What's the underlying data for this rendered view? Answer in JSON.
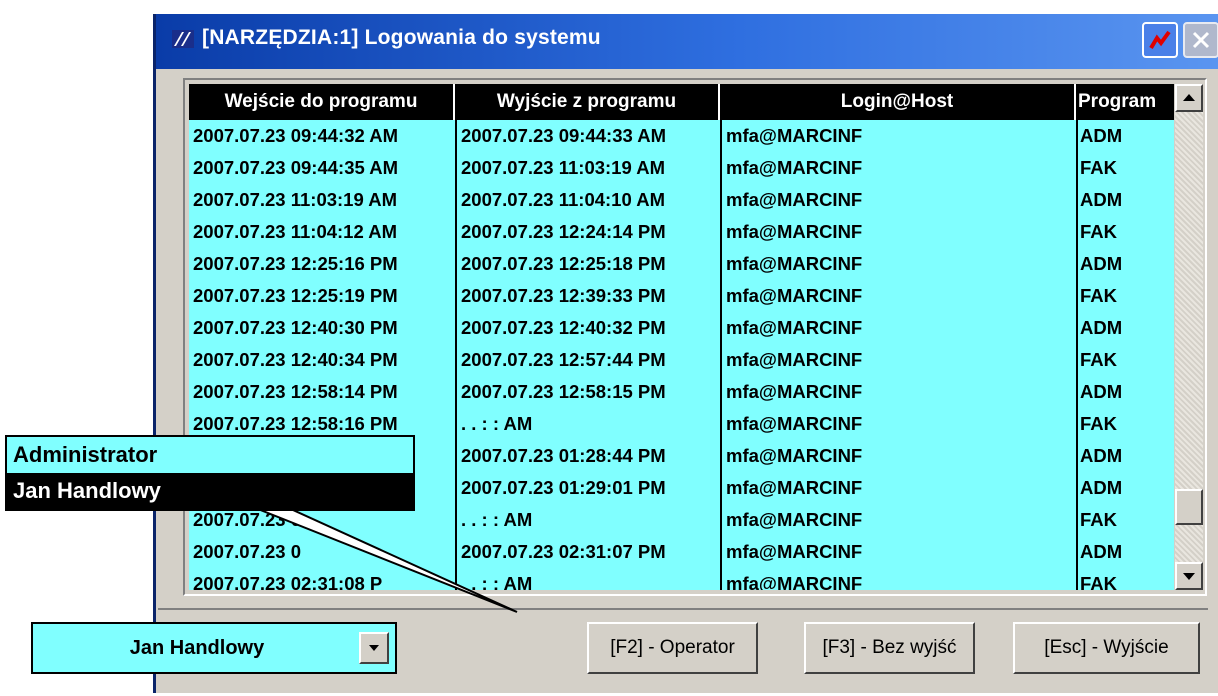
{
  "window": {
    "title": "[NARZĘDZIA:1]  Logowania do systemu"
  },
  "columns": [
    "Wejście do programu",
    "Wyjście z programu",
    "Login@Host",
    "Program"
  ],
  "rows": [
    [
      "2007.07.23 09:44:32 AM",
      "2007.07.23 09:44:33 AM",
      "mfa@MARCINF",
      "ADM"
    ],
    [
      "2007.07.23 09:44:35 AM",
      "2007.07.23 11:03:19 AM",
      "mfa@MARCINF",
      "FAK"
    ],
    [
      "2007.07.23 11:03:19 AM",
      "2007.07.23 11:04:10 AM",
      "mfa@MARCINF",
      "ADM"
    ],
    [
      "2007.07.23 11:04:12 AM",
      "2007.07.23 12:24:14 PM",
      "mfa@MARCINF",
      "FAK"
    ],
    [
      "2007.07.23 12:25:16 PM",
      "2007.07.23 12:25:18 PM",
      "mfa@MARCINF",
      "ADM"
    ],
    [
      "2007.07.23 12:25:19 PM",
      "2007.07.23 12:39:33 PM",
      "mfa@MARCINF",
      "FAK"
    ],
    [
      "2007.07.23 12:40:30 PM",
      "2007.07.23 12:40:32 PM",
      "mfa@MARCINF",
      "ADM"
    ],
    [
      "2007.07.23 12:40:34 PM",
      "2007.07.23 12:57:44 PM",
      "mfa@MARCINF",
      "FAK"
    ],
    [
      "2007.07.23 12:58:14 PM",
      "2007.07.23 12:58:15 PM",
      "mfa@MARCINF",
      "ADM"
    ],
    [
      "2007.07.23 12:58:16 PM",
      ". .   : :  AM",
      "mfa@MARCINF",
      "FAK"
    ],
    [
      "",
      "2007.07.23 01:28:44 PM",
      "mfa@MARCINF",
      "ADM"
    ],
    [
      "",
      "2007.07.23 01:29:01 PM",
      "mfa@MARCINF",
      "ADM"
    ],
    [
      "2007.07.23 0",
      ". .   : :  AM",
      "mfa@MARCINF",
      "FAK"
    ],
    [
      "2007.07.23 0",
      "2007.07.23 02:31:07 PM",
      "mfa@MARCINF",
      "ADM"
    ],
    [
      "2007.07.23 02:31:08 P",
      ". .   : :  AM",
      "mfa@MARCINF",
      "FAK"
    ]
  ],
  "operator_select": {
    "value": "Jan Handlowy",
    "options": [
      "Administrator",
      "Jan Handlowy"
    ],
    "selected_index": 1
  },
  "buttons": {
    "operator": "[F2] - Operator",
    "bez_wyjsc": "[F3] - Bez wyjść",
    "wyjscie": "[Esc] - Wyjście"
  },
  "colors": {
    "grid_bg": "#80ffff",
    "header_bg": "#000000",
    "title_bar": "#0a3ca8",
    "face": "#d4d0c8"
  },
  "icons": {
    "app": "app-logo-icon",
    "title_button": "chart-icon",
    "close": "close-icon",
    "scroll_up": "arrow-up-icon",
    "scroll_down": "arrow-down-icon",
    "dropdown": "chevron-down-icon"
  }
}
